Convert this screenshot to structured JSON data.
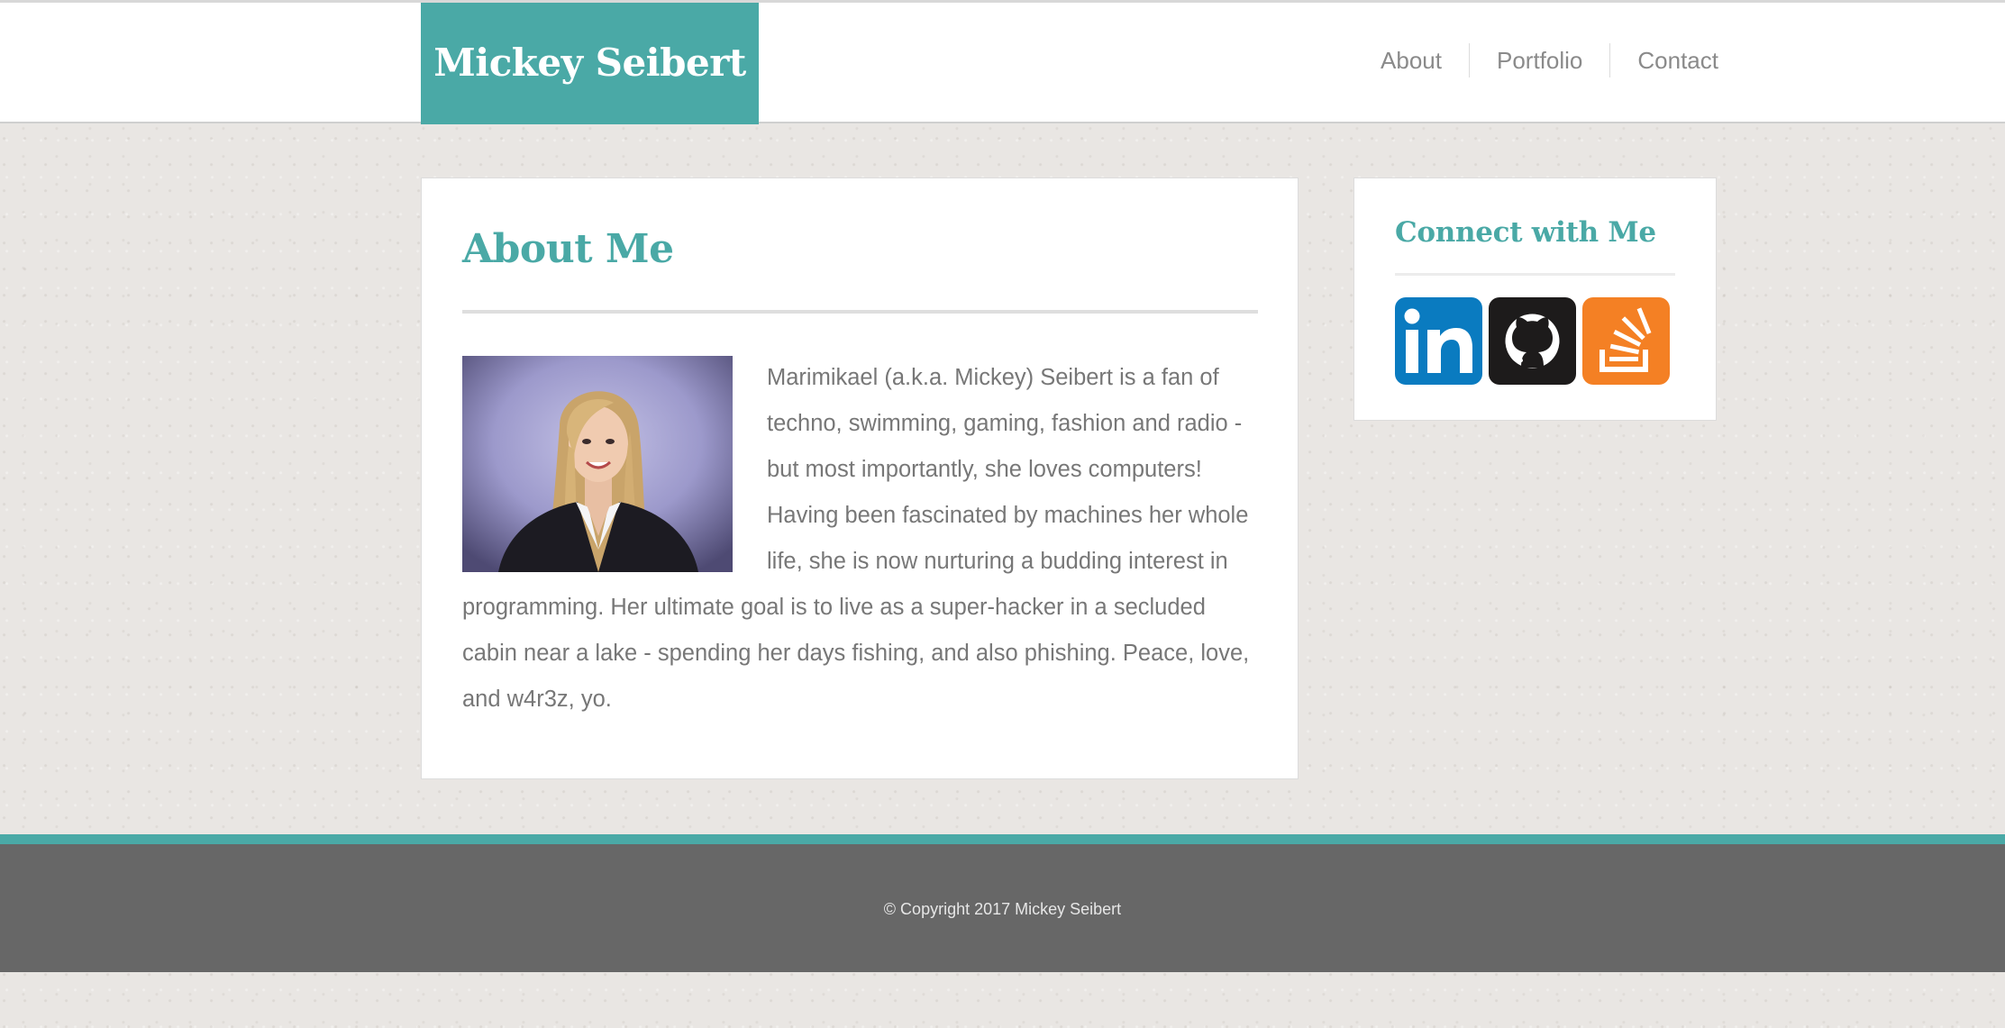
{
  "header": {
    "logo": "Mickey Seibert",
    "nav": [
      {
        "label": "About"
      },
      {
        "label": "Portfolio"
      },
      {
        "label": "Contact"
      }
    ]
  },
  "main": {
    "title": "About Me",
    "photo_icon": "portrait-photo",
    "bio": "Marimikael (a.k.a. Mickey) Seibert is a fan of techno, swimming, gaming, fashion and radio - but most importantly, she loves computers! Having been fascinated by machines her whole life, she is now nurturing a budding interest in programming. Her ultimate goal is to live as a super-hacker in a secluded cabin near a lake - spending her days fishing, and also phishing. Peace, love, and w4r3z, yo."
  },
  "sidebar": {
    "title": "Connect with Me",
    "links": [
      {
        "icon": "linkedin-icon",
        "color": "#0a7bc0"
      },
      {
        "icon": "github-icon",
        "color": "#1d1b1b"
      },
      {
        "icon": "stackoverflow-icon",
        "color": "#f48024"
      }
    ]
  },
  "footer": {
    "copyright": "© Copyright 2017 Mickey Seibert"
  },
  "colors": {
    "accent": "#4aa9a6",
    "footer_bg": "#676767",
    "text": "#777777"
  }
}
